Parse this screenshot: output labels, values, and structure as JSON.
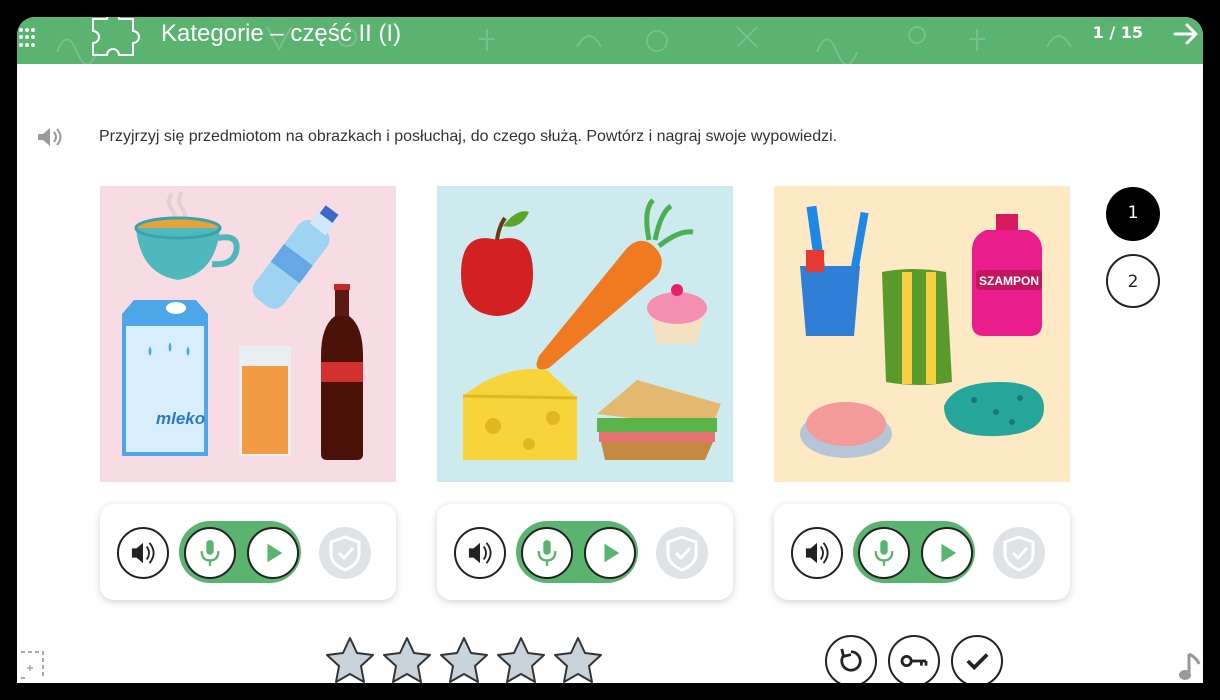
{
  "header": {
    "title": "Kategorie – część II (I)",
    "counter": "1 / 15",
    "menu_icon": "grid-menu-icon",
    "category_icon": "puzzle-icon",
    "next_icon": "arrow-right-icon",
    "background_color": "#5ab36f"
  },
  "instruction": {
    "text": "Przyjrzyj się przedmiotom na obrazkach i posłuchaj, do czego służą. Powtórz i nagraj swoje wypowiedzi.",
    "icon": "speaker-icon"
  },
  "cards": [
    {
      "background": "#f7dde3",
      "image": "drinks-illustration",
      "label": "mleko"
    },
    {
      "background": "#cdebef",
      "image": "food-illustration"
    },
    {
      "background": "#fde9c4",
      "image": "hygiene-illustration",
      "label": "SZAMPON"
    }
  ],
  "card_controls": {
    "speaker_icon": "speaker-icon",
    "mic_icon": "microphone-icon",
    "play_icon": "play-icon",
    "check_icon": "shield-check-icon",
    "accent": "#5ab36f"
  },
  "pages": {
    "items": [
      "1",
      "2"
    ],
    "active": "1"
  },
  "rating": {
    "stars_total": 5,
    "stars_filled": 0
  },
  "bottom_actions": {
    "reset_icon": "reset-icon",
    "key_icon": "key-icon",
    "check_icon": "checkmark-icon"
  },
  "corner_icons": {
    "fullscreen": "fullscreen-icon",
    "music": "music-note-icon"
  }
}
